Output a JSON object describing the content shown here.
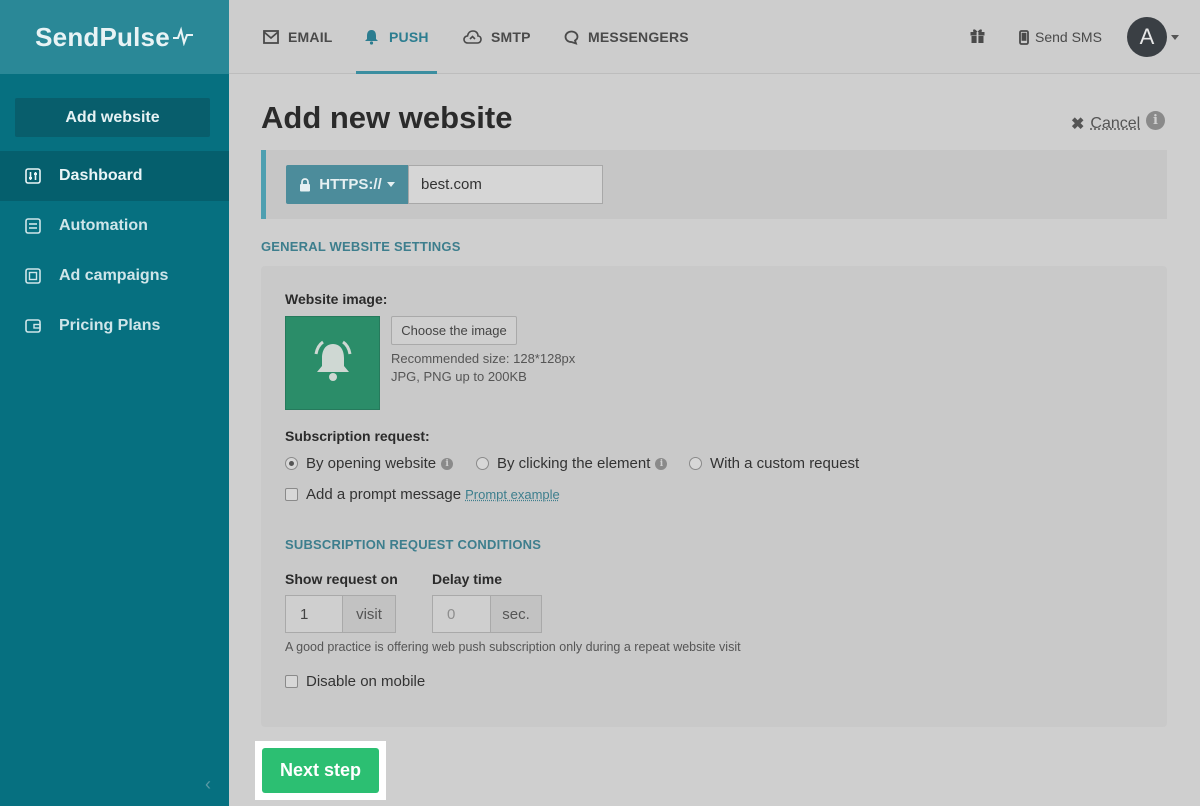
{
  "brand": {
    "logo_text": "SendPulse"
  },
  "sidebar": {
    "add_website": "Add website",
    "items": [
      {
        "label": "Dashboard",
        "icon": "sliders-icon",
        "active": true
      },
      {
        "label": "Automation",
        "icon": "automation-icon",
        "active": false
      },
      {
        "label": "Ad campaigns",
        "icon": "ad-campaigns-icon",
        "active": false
      },
      {
        "label": "Pricing Plans",
        "icon": "wallet-icon",
        "active": false
      }
    ],
    "collapse_glyph": "‹"
  },
  "topbar": {
    "tabs": [
      {
        "label": "EMAIL",
        "icon": "envelope-icon",
        "active": false
      },
      {
        "label": "PUSH",
        "icon": "bell-icon",
        "active": true
      },
      {
        "label": "SMTP",
        "icon": "cloud-upload-icon",
        "active": false
      },
      {
        "label": "MESSENGERS",
        "icon": "chat-bubble-icon",
        "active": false
      }
    ],
    "send_sms": "Send SMS",
    "avatar_letter": "A"
  },
  "page": {
    "title": "Add new website",
    "cancel": "Cancel",
    "protocol": "HTTPS://",
    "domain_value": "best.com"
  },
  "general": {
    "heading": "GENERAL WEBSITE SETTINGS",
    "website_image_label": "Website image:",
    "choose_image": "Choose the image",
    "recommended_size": "Recommended size: 128*128px",
    "formats": "JPG, PNG up to 200KB",
    "subscription_label": "Subscription request:",
    "options": [
      {
        "label": "By opening website",
        "checked": true,
        "info": true
      },
      {
        "label": "By clicking the element",
        "checked": false,
        "info": true
      },
      {
        "label": "With a custom request",
        "checked": false,
        "info": false
      }
    ],
    "prompt_message": "Add a prompt message",
    "prompt_example": "Prompt example"
  },
  "conditions": {
    "heading": "SUBSCRIPTION REQUEST CONDITIONS",
    "show_request_label": "Show request on",
    "show_request_value": "1",
    "show_request_unit": "visit",
    "delay_label": "Delay time",
    "delay_placeholder": "0",
    "delay_unit": "sec.",
    "good_practice": "A good practice is offering web push subscription only during a repeat website visit",
    "disable_mobile": "Disable on mobile"
  },
  "actions": {
    "next_step": "Next step"
  },
  "colors": {
    "sidebar": "#067080",
    "accent": "#2c7d90",
    "next": "#2cbf72",
    "image_tile": "#2b8d69"
  }
}
